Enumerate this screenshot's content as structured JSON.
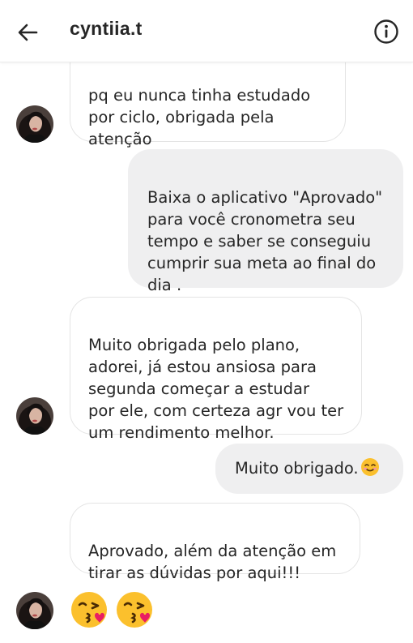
{
  "header": {
    "username": "cyntiia.t",
    "back_icon": "arrow-left-icon",
    "info_icon": "info-icon"
  },
  "messages": [
    {
      "id": "m1",
      "direction": "incoming",
      "text": "pq eu nunca tinha estudado\npor ciclo, obrigada pela\natenção"
    },
    {
      "id": "m2",
      "direction": "outgoing",
      "text": "Baixa o aplicativo \"Aprovado\"\npara você cronometra seu\ntempo e saber se conseguiu\ncumprir sua meta ao final do\ndia ."
    },
    {
      "id": "m3",
      "direction": "incoming",
      "text": "Muito obrigada pelo plano,\nadorei, já estou ansiosa para\nsegunda começar a estudar\npor ele, com certeza agr vou ter\num rendimento melhor."
    },
    {
      "id": "m4",
      "direction": "outgoing",
      "text": "Muito obrigado.",
      "emoji": "smiling-face-icon"
    },
    {
      "id": "m5",
      "direction": "incoming",
      "text": "Aprovado, além da atenção em\ntirar as dúvidas por aqui!!!"
    },
    {
      "id": "m6",
      "direction": "incoming",
      "emoji_count": 2,
      "emoji": "kissing-face-icon"
    }
  ],
  "colors": {
    "outgoing_bubble": "#efeff0",
    "incoming_border": "#e4e4e4",
    "text": "#262626",
    "emoji_yellow": "#fbc02d",
    "emoji_heart": "#e91e63"
  }
}
